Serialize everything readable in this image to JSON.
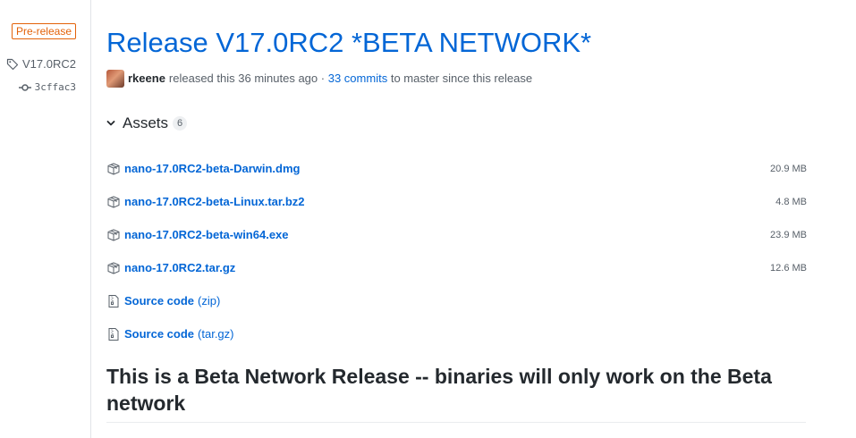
{
  "sidebar": {
    "badge": "Pre-release",
    "tag": "V17.0RC2",
    "commit": "3cffac3"
  },
  "release": {
    "title": "Release V17.0RC2 *BETA NETWORK*",
    "author": "rkeene",
    "released_text": "released this 36 minutes ago",
    "separator": "·",
    "commits_link": "33 commits",
    "commits_suffix": "to master since this release"
  },
  "assets": {
    "label": "Assets",
    "count": "6",
    "items": [
      {
        "name": "nano-17.0RC2-beta-Darwin.dmg",
        "size": "20.9 MB",
        "icon": "package-icon"
      },
      {
        "name": "nano-17.0RC2-beta-Linux.tar.bz2",
        "size": "4.8 MB",
        "icon": "package-icon"
      },
      {
        "name": "nano-17.0RC2-beta-win64.exe",
        "size": "23.9 MB",
        "icon": "package-icon"
      },
      {
        "name": "nano-17.0RC2.tar.gz",
        "size": "12.6 MB",
        "icon": "package-icon"
      },
      {
        "name": "Source code",
        "suffix": "(zip)",
        "icon": "file-zip-icon"
      },
      {
        "name": "Source code",
        "suffix": "(tar.gz)",
        "icon": "file-zip-icon"
      }
    ]
  },
  "notes": {
    "heading": "This is a Beta Network Release -- binaries will only work on the Beta network"
  },
  "colors": {
    "link": "#0366d6",
    "prerelease": "#e36209",
    "text": "#24292e",
    "muted": "#586069"
  }
}
